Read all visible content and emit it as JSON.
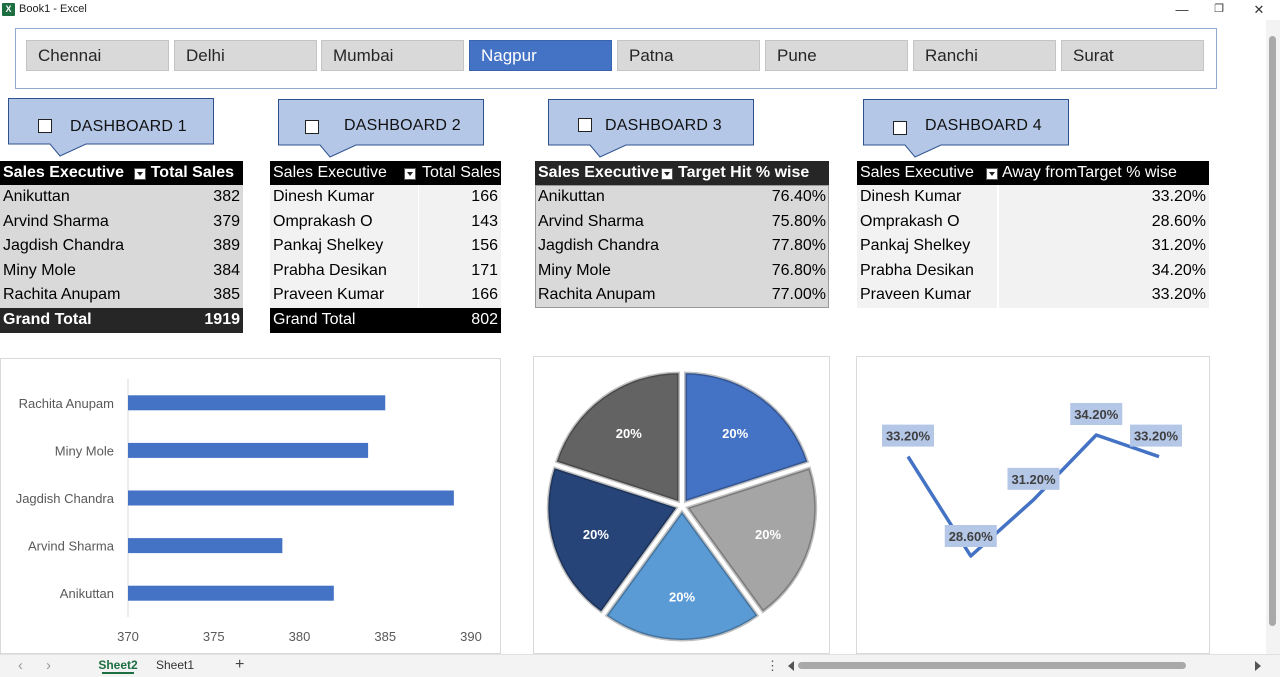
{
  "window": {
    "title": "Book1 - Excel",
    "app_icon": "excel-icon",
    "minimize": "—",
    "restore": "❐",
    "close": "✕"
  },
  "slicer": {
    "items": [
      {
        "label": "Chennai",
        "selected": false
      },
      {
        "label": "Delhi",
        "selected": false
      },
      {
        "label": "Mumbai",
        "selected": false
      },
      {
        "label": "Nagpur",
        "selected": true
      },
      {
        "label": "Patna",
        "selected": false
      },
      {
        "label": "Pune",
        "selected": false
      },
      {
        "label": "Ranchi",
        "selected": false
      },
      {
        "label": "Surat",
        "selected": false
      }
    ]
  },
  "dashboards": [
    {
      "label": "DASHBOARD 1"
    },
    {
      "label": "DASHBOARD 2"
    },
    {
      "label": "DASHBOARD 3"
    },
    {
      "label": "DASHBOARD 4"
    }
  ],
  "tables": {
    "t1": {
      "headers": [
        "Sales Executive",
        "Total Sales"
      ],
      "rows": [
        [
          "Anikuttan",
          "382"
        ],
        [
          "Arvind Sharma",
          "379"
        ],
        [
          "Jagdish Chandra",
          "389"
        ],
        [
          "Miny Mole",
          "384"
        ],
        [
          "Rachita Anupam",
          "385"
        ]
      ],
      "total": [
        "Grand Total",
        "1919"
      ]
    },
    "t2": {
      "headers": [
        "Sales Executive",
        "Total Sales"
      ],
      "rows": [
        [
          "Dinesh Kumar",
          "166"
        ],
        [
          "Omprakash O",
          "143"
        ],
        [
          "Pankaj Shelkey",
          "156"
        ],
        [
          "Prabha Desikan",
          "171"
        ],
        [
          "Praveen Kumar",
          "166"
        ]
      ],
      "total": [
        "Grand Total",
        "802"
      ]
    },
    "t3": {
      "headers": [
        "Sales Executive",
        "Target Hit % wise"
      ],
      "rows": [
        [
          "Anikuttan",
          "76.40%"
        ],
        [
          "Arvind Sharma",
          "75.80%"
        ],
        [
          "Jagdish Chandra",
          "77.80%"
        ],
        [
          "Miny Mole",
          "76.80%"
        ],
        [
          "Rachita Anupam",
          "77.00%"
        ]
      ]
    },
    "t4": {
      "headers": [
        "Sales Executive",
        "Away fromTarget % wise"
      ],
      "rows": [
        [
          "Dinesh Kumar",
          "33.20%"
        ],
        [
          "Omprakash O",
          "28.60%"
        ],
        [
          "Pankaj Shelkey",
          "31.20%"
        ],
        [
          "Prabha Desikan",
          "34.20%"
        ],
        [
          "Praveen Kumar",
          "33.20%"
        ]
      ]
    }
  },
  "chart_data": [
    {
      "type": "bar",
      "orientation": "horizontal",
      "categories": [
        "Anikuttan",
        "Arvind Sharma",
        "Jagdish Chandra",
        "Miny Mole",
        "Rachita Anupam"
      ],
      "values": [
        382,
        379,
        389,
        384,
        385
      ],
      "xlim": [
        370,
        390
      ],
      "xticks": [
        "370",
        "375",
        "380",
        "385",
        "390"
      ],
      "color": "#4472c4",
      "grid": false
    },
    {
      "type": "pie",
      "values": [
        20,
        20,
        20,
        20,
        20
      ],
      "labels": [
        "20%",
        "20%",
        "20%",
        "20%",
        "20%"
      ],
      "colors": [
        "#4472c4",
        "#a5a5a5",
        "#5b9bd5",
        "#264478",
        "#636363"
      ]
    },
    {
      "type": "line",
      "values": [
        33.2,
        28.6,
        31.2,
        34.2,
        33.2
      ],
      "labels": [
        "33.20%",
        "28.60%",
        "31.20%",
        "34.20%",
        "33.20%"
      ],
      "color": "#4472c4",
      "label_fill": "#b4c7e7"
    }
  ],
  "sheets": {
    "tabs": [
      {
        "label": "Sheet2",
        "active": true
      },
      {
        "label": "Sheet1",
        "active": false
      }
    ],
    "add": "+",
    "nav_prev": "‹",
    "nav_next": "›",
    "more": "⋮"
  }
}
